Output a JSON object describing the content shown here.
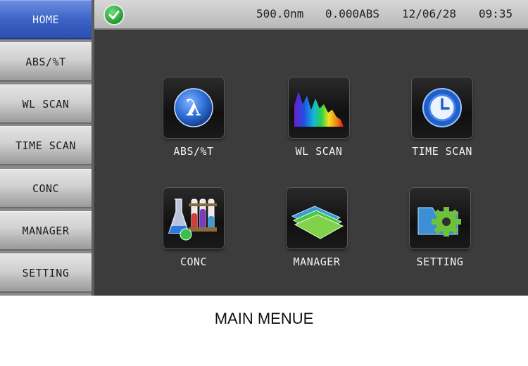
{
  "sidebar": {
    "items": [
      {
        "label": "HOME",
        "active": true
      },
      {
        "label": "ABS/%T",
        "active": false
      },
      {
        "label": "WL SCAN",
        "active": false
      },
      {
        "label": "TIME SCAN",
        "active": false
      },
      {
        "label": "CONC",
        "active": false
      },
      {
        "label": "MANAGER",
        "active": false
      },
      {
        "label": "SETTING",
        "active": false
      }
    ]
  },
  "status": {
    "icon": "checkmark-icon",
    "wavelength": "500.0nm",
    "absorbance": "0.000ABS",
    "date": "12/06/28",
    "time": "09:35"
  },
  "apps": [
    {
      "label": "ABS/%T",
      "icon": "lambda-icon"
    },
    {
      "label": "WL SCAN",
      "icon": "spectrum-icon"
    },
    {
      "label": "TIME SCAN",
      "icon": "clock-icon"
    },
    {
      "label": "CONC",
      "icon": "flasks-icon"
    },
    {
      "label": "MANAGER",
      "icon": "folders-icon"
    },
    {
      "label": "SETTING",
      "icon": "folder-gear-icon"
    }
  ],
  "caption": "MAIN MENUE",
  "colors": {
    "accent": "#3c63c8",
    "background": "#3c3c3c",
    "ok": "#1f9a30"
  }
}
